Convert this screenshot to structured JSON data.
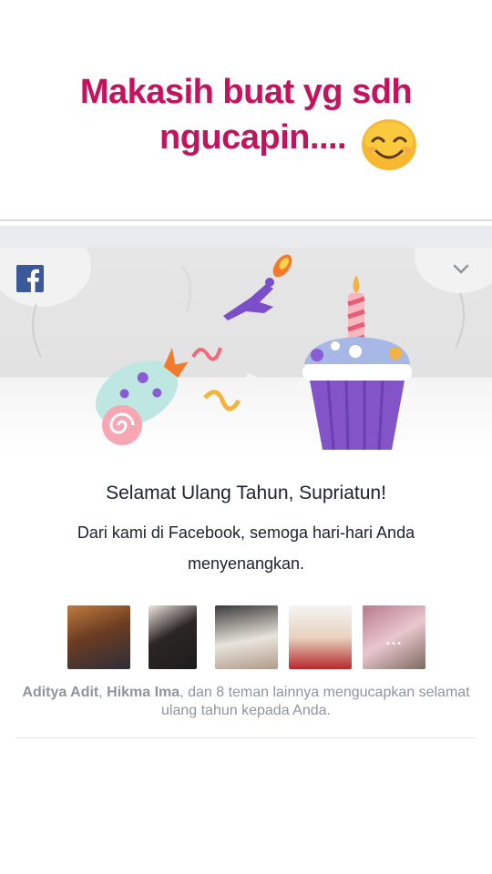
{
  "caption": {
    "line1": "Makasih buat yg sdh",
    "line2": "ngucapin....",
    "emoji_icon": "smiling-face-icon"
  },
  "card": {
    "brand_icon": "facebook-logo-icon",
    "menu_icon": "chevron-down-icon",
    "greeting": "Selamat Ulang Tahun, Supriatun!",
    "message": "Dari kami di Facebook, semoga hari-hari Anda menyenangkan.",
    "friends": [
      {
        "name": "Aditya Adit"
      },
      {
        "name": "Hikma Ima"
      },
      {
        "name": ""
      },
      {
        "name": ""
      },
      {
        "name": "",
        "more_label": "..."
      }
    ],
    "summary": {
      "name1": "Aditya Adit",
      "sep": ", ",
      "name2": "Hikma Ima",
      "rest": ", dan 8 teman lainnya mengucapkan selamat ulang tahun kepada Anda."
    }
  },
  "colors": {
    "caption": "#c4135e",
    "facebook_blue": "#3b5998",
    "muted_text": "#90949c"
  }
}
